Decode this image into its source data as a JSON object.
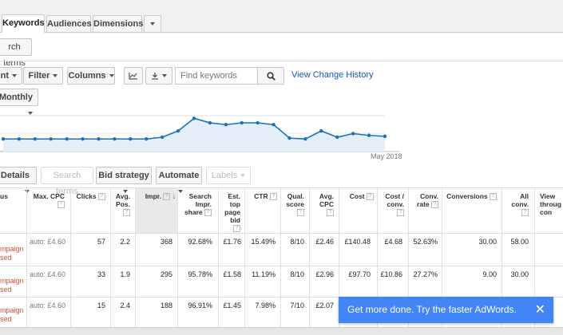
{
  "tabs": [
    {
      "label": "Keywords",
      "active": true
    },
    {
      "label": "Audiences",
      "active": false
    },
    {
      "label": "Dimensions",
      "active": false
    }
  ],
  "search_terms_button": "rch terms",
  "toolbar": {
    "first_partial": "nt",
    "filter": "Filter",
    "columns": "Columns",
    "search_placeholder": "Find keywords",
    "view_change_history": "View Change History",
    "period": "Monthly"
  },
  "chart_data": {
    "type": "line",
    "x_label_visible": "May 2018",
    "values": [
      14,
      14,
      14,
      14,
      14,
      14,
      14,
      14,
      14,
      14,
      16,
      23,
      37,
      32,
      30,
      32,
      32,
      30,
      15,
      14,
      23,
      16,
      20,
      18,
      17
    ],
    "ylim": [
      0,
      40
    ],
    "color": "#1a73b8",
    "fill_color": "#e3eef8"
  },
  "secondary_toolbar": {
    "details": "Details",
    "search_terms": "Search terms",
    "bid_strategy": "Bid strategy",
    "automate": "Automate",
    "labels": "Labels"
  },
  "table": {
    "headers": {
      "status": "us",
      "max_cpc": "Max. CPC",
      "clicks": "Clicks",
      "avg_pos": "Avg. Pos.",
      "impr": "Impr.",
      "search_impr_share": "Search Impr. share",
      "est_top": "Est. top page bid",
      "ctr": "CTR",
      "qual_score": "Qual. score",
      "avg_cpc": "Avg. CPC",
      "cost": "Cost",
      "cost_conv": "Cost / conv.",
      "conv_rate": "Conv. rate",
      "conversions": "Conversions",
      "all_conv": "All conv.",
      "view_through": "View throug con"
    },
    "rows": [
      {
        "status1": "mpaign",
        "status2": "sed",
        "max_cpc": "auto: £4.60",
        "clicks": "57",
        "avg_pos": "2.2",
        "impr": "368",
        "share": "92.68%",
        "est_top": "£1.76",
        "ctr": "15.49%",
        "qual": "8/10",
        "avg_cpc": "£2.46",
        "cost": "£140.48",
        "cost_conv": "£4.68",
        "conv_rate": "52.63%",
        "conversions": "30.00",
        "all_conv": "58.00"
      },
      {
        "status1": "mpaign",
        "status2": "sed",
        "max_cpc": "auto: £4.60",
        "clicks": "33",
        "avg_pos": "1.9",
        "impr": "295",
        "share": "95.78%",
        "est_top": "£1.58",
        "ctr": "11.19%",
        "qual": "8/10",
        "avg_cpc": "£2.96",
        "cost": "£97.70",
        "cost_conv": "£10.86",
        "conv_rate": "27.27%",
        "conversions": "9.00",
        "all_conv": "30.00"
      },
      {
        "status1": "mpaign",
        "status2": "sed",
        "max_cpc": "auto: £4.60",
        "clicks": "15",
        "avg_pos": "2.4",
        "impr": "188",
        "share": "96.91%",
        "est_top": "£1.45",
        "ctr": "7.98%",
        "qual": "7/10",
        "avg_cpc": "£2.07"
      }
    ]
  },
  "toast": {
    "message": "Get more done. Try the faster AdWords."
  }
}
